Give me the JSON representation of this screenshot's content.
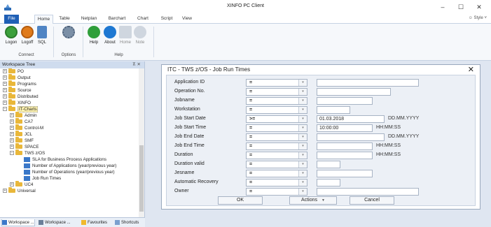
{
  "window": {
    "title": "XINFO PC Client",
    "controls": {
      "minimize": "–",
      "maximize": "☐",
      "close": "✕"
    }
  },
  "ribbon_tabs": [
    "File",
    "Home",
    "Table",
    "Netplan",
    "Barchart",
    "Chart",
    "Script",
    "View"
  ],
  "style_menu": "☺ Style ˅",
  "ribbon": {
    "groups": {
      "connect": "Connect",
      "options": "Options",
      "help": "Help"
    },
    "buttons": {
      "logon": "Logon",
      "logoff": "Logoff",
      "sql": "SQL",
      "help": "Help",
      "about": "About",
      "home": "Home",
      "note": "Note"
    }
  },
  "workspace_tree": {
    "title": "Workspace Tree",
    "pin": "⊼ ✕",
    "items": [
      {
        "label": "PO",
        "expander": "+"
      },
      {
        "label": "Output",
        "expander": "+"
      },
      {
        "label": "Programs",
        "expander": "+"
      },
      {
        "label": "Source",
        "expander": "+"
      },
      {
        "label": "Distributed",
        "expander": "+"
      },
      {
        "label": "XINFO",
        "expander": "+"
      },
      {
        "label": "IT-Charts",
        "expander": "−"
      },
      {
        "label": "Admin",
        "expander": "+"
      },
      {
        "label": "CA7",
        "expander": "+"
      },
      {
        "label": "Control-M",
        "expander": "+"
      },
      {
        "label": "JCL",
        "expander": "+"
      },
      {
        "label": "SMF",
        "expander": "+"
      },
      {
        "label": "SPACE",
        "expander": "+"
      },
      {
        "label": "TWS z/OS",
        "expander": "−"
      },
      {
        "label": "SLA for Business Process Applications"
      },
      {
        "label": "Number of Applications (year/previous year)"
      },
      {
        "label": "Number of Operations (year/previous year)"
      },
      {
        "label": "Job Run Times"
      },
      {
        "label": "UC4",
        "expander": "+"
      },
      {
        "label": "Universal",
        "expander": "+"
      }
    ],
    "footer_tabs": [
      "Workspace ...",
      "Workspace ...",
      "Favourites",
      "Shortcuts"
    ]
  },
  "dialog": {
    "title": "ITC - TWS z/OS - Job Run Times",
    "close": "✕",
    "fields": [
      {
        "label": "Application ID",
        "op": "=",
        "value": "",
        "hint": ""
      },
      {
        "label": "Operation No.",
        "op": "=",
        "value": "",
        "hint": ""
      },
      {
        "label": "Jobname",
        "op": "=",
        "value": "",
        "hint": ""
      },
      {
        "label": "Workstation",
        "op": "=",
        "value": "",
        "hint": ""
      },
      {
        "label": "Job Start Date",
        "op": ">=",
        "value": "01.03.2018",
        "hint": "DD.MM.YYYY"
      },
      {
        "label": "Job Start Time",
        "op": "=",
        "value": "10:00:00",
        "hint": "HH:MM:SS"
      },
      {
        "label": "Job End Date",
        "op": "=",
        "value": "",
        "hint": "DD.MM.YYYY"
      },
      {
        "label": "Job End Time",
        "op": "=",
        "value": "",
        "hint": "HH:MM:SS"
      },
      {
        "label": "Duration",
        "op": "=",
        "value": "",
        "hint": "HH:MM:SS"
      },
      {
        "label": "Duration valid",
        "op": "=",
        "value": "",
        "hint": ""
      },
      {
        "label": "Jesname",
        "op": "=",
        "value": "",
        "hint": ""
      },
      {
        "label": "Automatic Recovery",
        "op": "=",
        "value": "",
        "hint": ""
      },
      {
        "label": "Owner",
        "op": "=",
        "value": "",
        "hint": ""
      }
    ],
    "buttons": {
      "ok": "OK",
      "actions": "Actions",
      "cancel": "Cancel"
    }
  }
}
